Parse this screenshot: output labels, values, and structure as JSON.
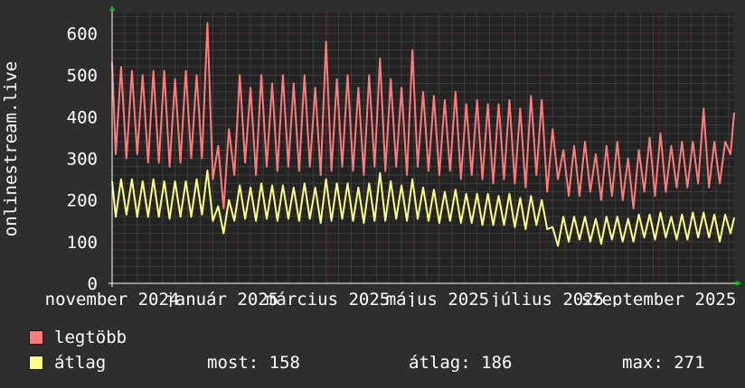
{
  "chart_data": {
    "type": "line",
    "ylabel": "onlinestream.live",
    "x_tick_labels": [
      "november 2024",
      "január 2025",
      "március 2025",
      "május 2025",
      "július 2025",
      "szeptember 2025"
    ],
    "x_range": [
      "2024-11-01",
      "2025-10-13"
    ],
    "x_tick_dates": [
      "2024-11-01",
      "2025-01-01",
      "2025-03-01",
      "2025-05-01",
      "2025-07-01",
      "2025-09-01"
    ],
    "ylim": [
      0,
      650
    ],
    "y_ticks": [
      0,
      100,
      200,
      300,
      400,
      500,
      600
    ],
    "grid": true,
    "series": [
      {
        "name": "legtöbb",
        "color": "#ff7b7b",
        "points": [
          [
            "2024-11-01",
            530
          ],
          [
            "2024-11-03",
            310
          ],
          [
            "2024-11-06",
            520
          ],
          [
            "2024-11-09",
            300
          ],
          [
            "2024-11-12",
            510
          ],
          [
            "2024-11-15",
            310
          ],
          [
            "2024-11-18",
            500
          ],
          [
            "2024-11-21",
            290
          ],
          [
            "2024-11-24",
            510
          ],
          [
            "2024-11-27",
            290
          ],
          [
            "2024-11-30",
            510
          ],
          [
            "2024-12-03",
            280
          ],
          [
            "2024-12-06",
            490
          ],
          [
            "2024-12-09",
            290
          ],
          [
            "2024-12-12",
            510
          ],
          [
            "2024-12-15",
            300
          ],
          [
            "2024-12-18",
            500
          ],
          [
            "2024-12-21",
            300
          ],
          [
            "2024-12-24",
            625
          ],
          [
            "2024-12-27",
            250
          ],
          [
            "2024-12-30",
            330
          ],
          [
            "2025-01-02",
            180
          ],
          [
            "2025-01-05",
            370
          ],
          [
            "2025-01-08",
            260
          ],
          [
            "2025-01-11",
            500
          ],
          [
            "2025-01-14",
            290
          ],
          [
            "2025-01-17",
            470
          ],
          [
            "2025-01-20",
            260
          ],
          [
            "2025-01-23",
            500
          ],
          [
            "2025-01-26",
            280
          ],
          [
            "2025-01-29",
            480
          ],
          [
            "2025-02-01",
            270
          ],
          [
            "2025-02-04",
            500
          ],
          [
            "2025-02-07",
            280
          ],
          [
            "2025-02-10",
            480
          ],
          [
            "2025-02-13",
            270
          ],
          [
            "2025-02-16",
            500
          ],
          [
            "2025-02-19",
            280
          ],
          [
            "2025-02-22",
            470
          ],
          [
            "2025-02-25",
            260
          ],
          [
            "2025-02-28",
            580
          ],
          [
            "2025-03-03",
            270
          ],
          [
            "2025-03-06",
            490
          ],
          [
            "2025-03-09",
            280
          ],
          [
            "2025-03-12",
            500
          ],
          [
            "2025-03-15",
            270
          ],
          [
            "2025-03-18",
            470
          ],
          [
            "2025-03-21",
            260
          ],
          [
            "2025-03-24",
            500
          ],
          [
            "2025-03-27",
            280
          ],
          [
            "2025-03-30",
            540
          ],
          [
            "2025-04-02",
            270
          ],
          [
            "2025-04-05",
            490
          ],
          [
            "2025-04-08",
            280
          ],
          [
            "2025-04-11",
            470
          ],
          [
            "2025-04-14",
            260
          ],
          [
            "2025-04-17",
            560
          ],
          [
            "2025-04-20",
            280
          ],
          [
            "2025-04-23",
            460
          ],
          [
            "2025-04-26",
            270
          ],
          [
            "2025-04-29",
            450
          ],
          [
            "2025-05-02",
            260
          ],
          [
            "2025-05-05",
            440
          ],
          [
            "2025-05-08",
            270
          ],
          [
            "2025-05-11",
            460
          ],
          [
            "2025-05-14",
            250
          ],
          [
            "2025-05-17",
            430
          ],
          [
            "2025-05-20",
            260
          ],
          [
            "2025-05-23",
            440
          ],
          [
            "2025-05-26",
            250
          ],
          [
            "2025-05-29",
            430
          ],
          [
            "2025-06-01",
            240
          ],
          [
            "2025-06-04",
            430
          ],
          [
            "2025-06-07",
            250
          ],
          [
            "2025-06-10",
            440
          ],
          [
            "2025-06-13",
            240
          ],
          [
            "2025-06-16",
            420
          ],
          [
            "2025-06-19",
            230
          ],
          [
            "2025-06-22",
            450
          ],
          [
            "2025-06-25",
            260
          ],
          [
            "2025-06-28",
            440
          ],
          [
            "2025-07-01",
            220
          ],
          [
            "2025-07-04",
            370
          ],
          [
            "2025-07-07",
            250
          ],
          [
            "2025-07-10",
            320
          ],
          [
            "2025-07-13",
            210
          ],
          [
            "2025-07-16",
            330
          ],
          [
            "2025-07-19",
            210
          ],
          [
            "2025-07-22",
            340
          ],
          [
            "2025-07-25",
            220
          ],
          [
            "2025-07-28",
            310
          ],
          [
            "2025-07-31",
            200
          ],
          [
            "2025-08-03",
            330
          ],
          [
            "2025-08-06",
            210
          ],
          [
            "2025-08-09",
            340
          ],
          [
            "2025-08-12",
            200
          ],
          [
            "2025-08-15",
            300
          ],
          [
            "2025-08-18",
            180
          ],
          [
            "2025-08-21",
            320
          ],
          [
            "2025-08-24",
            220
          ],
          [
            "2025-08-27",
            350
          ],
          [
            "2025-08-30",
            210
          ],
          [
            "2025-09-02",
            360
          ],
          [
            "2025-09-05",
            220
          ],
          [
            "2025-09-08",
            330
          ],
          [
            "2025-09-11",
            230
          ],
          [
            "2025-09-14",
            340
          ],
          [
            "2025-09-17",
            230
          ],
          [
            "2025-09-20",
            340
          ],
          [
            "2025-09-23",
            240
          ],
          [
            "2025-09-26",
            420
          ],
          [
            "2025-09-29",
            230
          ],
          [
            "2025-10-02",
            340
          ],
          [
            "2025-10-05",
            240
          ],
          [
            "2025-10-08",
            340
          ],
          [
            "2025-10-11",
            310
          ],
          [
            "2025-10-13",
            410
          ]
        ]
      },
      {
        "name": "átlag",
        "color": "#ffff80",
        "points": [
          [
            "2024-11-01",
            245
          ],
          [
            "2024-11-03",
            160
          ],
          [
            "2024-11-06",
            250
          ],
          [
            "2024-11-09",
            165
          ],
          [
            "2024-11-12",
            250
          ],
          [
            "2024-11-15",
            160
          ],
          [
            "2024-11-18",
            245
          ],
          [
            "2024-11-21",
            160
          ],
          [
            "2024-11-24",
            250
          ],
          [
            "2024-11-27",
            160
          ],
          [
            "2024-11-30",
            245
          ],
          [
            "2024-12-03",
            155
          ],
          [
            "2024-12-06",
            245
          ],
          [
            "2024-12-09",
            160
          ],
          [
            "2024-12-12",
            245
          ],
          [
            "2024-12-15",
            160
          ],
          [
            "2024-12-18",
            250
          ],
          [
            "2024-12-21",
            165
          ],
          [
            "2024-12-24",
            271
          ],
          [
            "2024-12-27",
            150
          ],
          [
            "2024-12-30",
            185
          ],
          [
            "2025-01-02",
            120
          ],
          [
            "2025-01-05",
            200
          ],
          [
            "2025-01-08",
            150
          ],
          [
            "2025-01-11",
            235
          ],
          [
            "2025-01-14",
            155
          ],
          [
            "2025-01-17",
            230
          ],
          [
            "2025-01-20",
            150
          ],
          [
            "2025-01-23",
            240
          ],
          [
            "2025-01-26",
            155
          ],
          [
            "2025-01-29",
            235
          ],
          [
            "2025-02-01",
            150
          ],
          [
            "2025-02-04",
            235
          ],
          [
            "2025-02-07",
            155
          ],
          [
            "2025-02-10",
            230
          ],
          [
            "2025-02-13",
            150
          ],
          [
            "2025-02-16",
            240
          ],
          [
            "2025-02-19",
            155
          ],
          [
            "2025-02-22",
            230
          ],
          [
            "2025-02-25",
            145
          ],
          [
            "2025-02-28",
            250
          ],
          [
            "2025-03-03",
            150
          ],
          [
            "2025-03-06",
            240
          ],
          [
            "2025-03-09",
            155
          ],
          [
            "2025-03-12",
            240
          ],
          [
            "2025-03-15",
            150
          ],
          [
            "2025-03-18",
            230
          ],
          [
            "2025-03-21",
            145
          ],
          [
            "2025-03-24",
            240
          ],
          [
            "2025-03-27",
            150
          ],
          [
            "2025-03-30",
            265
          ],
          [
            "2025-04-02",
            150
          ],
          [
            "2025-04-05",
            245
          ],
          [
            "2025-04-08",
            155
          ],
          [
            "2025-04-11",
            235
          ],
          [
            "2025-04-14",
            150
          ],
          [
            "2025-04-17",
            250
          ],
          [
            "2025-04-20",
            155
          ],
          [
            "2025-04-23",
            230
          ],
          [
            "2025-04-26",
            150
          ],
          [
            "2025-04-29",
            225
          ],
          [
            "2025-05-02",
            145
          ],
          [
            "2025-05-05",
            220
          ],
          [
            "2025-05-08",
            150
          ],
          [
            "2025-05-11",
            225
          ],
          [
            "2025-05-14",
            145
          ],
          [
            "2025-05-17",
            215
          ],
          [
            "2025-05-20",
            145
          ],
          [
            "2025-05-23",
            215
          ],
          [
            "2025-05-26",
            140
          ],
          [
            "2025-05-29",
            215
          ],
          [
            "2025-06-01",
            140
          ],
          [
            "2025-06-04",
            210
          ],
          [
            "2025-06-07",
            140
          ],
          [
            "2025-06-10",
            215
          ],
          [
            "2025-06-13",
            135
          ],
          [
            "2025-06-16",
            205
          ],
          [
            "2025-06-19",
            130
          ],
          [
            "2025-06-22",
            210
          ],
          [
            "2025-06-25",
            140
          ],
          [
            "2025-06-28",
            200
          ],
          [
            "2025-07-01",
            130
          ],
          [
            "2025-07-04",
            135
          ],
          [
            "2025-07-07",
            90
          ],
          [
            "2025-07-10",
            160
          ],
          [
            "2025-07-13",
            100
          ],
          [
            "2025-07-16",
            160
          ],
          [
            "2025-07-19",
            105
          ],
          [
            "2025-07-22",
            160
          ],
          [
            "2025-07-25",
            100
          ],
          [
            "2025-07-28",
            155
          ],
          [
            "2025-07-31",
            95
          ],
          [
            "2025-08-03",
            160
          ],
          [
            "2025-08-06",
            105
          ],
          [
            "2025-08-09",
            160
          ],
          [
            "2025-08-12",
            100
          ],
          [
            "2025-08-15",
            155
          ],
          [
            "2025-08-18",
            100
          ],
          [
            "2025-08-21",
            165
          ],
          [
            "2025-08-24",
            110
          ],
          [
            "2025-08-27",
            165
          ],
          [
            "2025-08-30",
            105
          ],
          [
            "2025-09-02",
            170
          ],
          [
            "2025-09-05",
            110
          ],
          [
            "2025-09-08",
            160
          ],
          [
            "2025-09-11",
            105
          ],
          [
            "2025-09-14",
            165
          ],
          [
            "2025-09-17",
            105
          ],
          [
            "2025-09-20",
            170
          ],
          [
            "2025-09-23",
            110
          ],
          [
            "2025-09-26",
            170
          ],
          [
            "2025-09-29",
            110
          ],
          [
            "2025-10-02",
            165
          ],
          [
            "2025-10-05",
            100
          ],
          [
            "2025-10-08",
            165
          ],
          [
            "2025-10-11",
            120
          ],
          [
            "2025-10-13",
            158
          ]
        ]
      }
    ]
  },
  "legend": [
    {
      "label": "legtöbb",
      "color": "#ff7b7b"
    },
    {
      "label": "átlag",
      "color": "#ffff80"
    }
  ],
  "stats": {
    "current": "most: 158",
    "average": "átlag: 186",
    "max": "max: 271"
  },
  "colors": {
    "background": "#2e2e2e",
    "plot_background": "#232323",
    "grid": "#7a1f1f",
    "axis_arrow": "#00cc00"
  }
}
